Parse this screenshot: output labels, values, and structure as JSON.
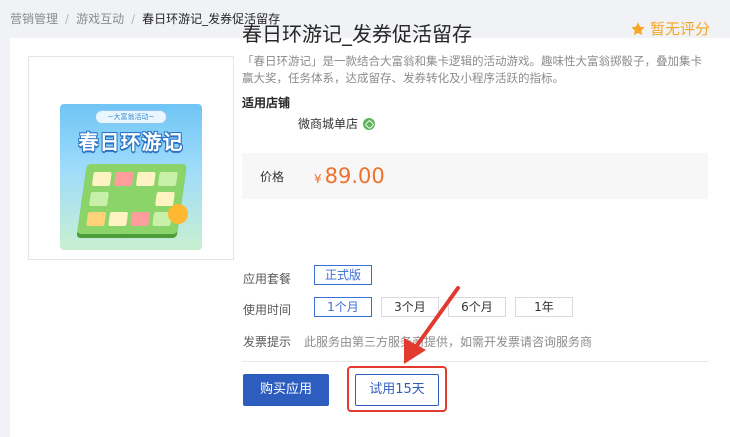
{
  "breadcrumb": {
    "items": [
      "营销管理",
      "游戏互动",
      "春日环游记_发券促活留存"
    ]
  },
  "product": {
    "title": "春日环游记_发券促活留存",
    "rating_text": "暂无评分",
    "description": "「春日环游记」是一款结合大富翁和集卡逻辑的活动游戏。趣味性大富翁掷骰子，叠加集卡赢大奖，任务体系，达成留存、发券转化及小程序活跃的指标。",
    "poster": {
      "ribbon": "~大富翁活动~",
      "title": "春日环游记"
    }
  },
  "shop": {
    "label": "适用店铺",
    "name": "微商城单店"
  },
  "price": {
    "label": "价格",
    "currency": "¥",
    "amount": "89.00"
  },
  "package": {
    "label": "应用套餐",
    "options": [
      "正式版"
    ],
    "selected": "正式版"
  },
  "duration": {
    "label": "使用时间",
    "options": [
      "1个月",
      "3个月",
      "6个月",
      "1年"
    ],
    "selected": "1个月"
  },
  "invoice": {
    "label": "发票提示",
    "text": "此服务由第三方服务商提供，如需开发票请咨询服务商"
  },
  "actions": {
    "buy_label": "购买应用",
    "trial_label": "试用15天"
  },
  "colors": {
    "primary": "#2d5dbf",
    "price": "#f0712c",
    "rating": "#f5a623",
    "highlight": "#e33a2f"
  }
}
